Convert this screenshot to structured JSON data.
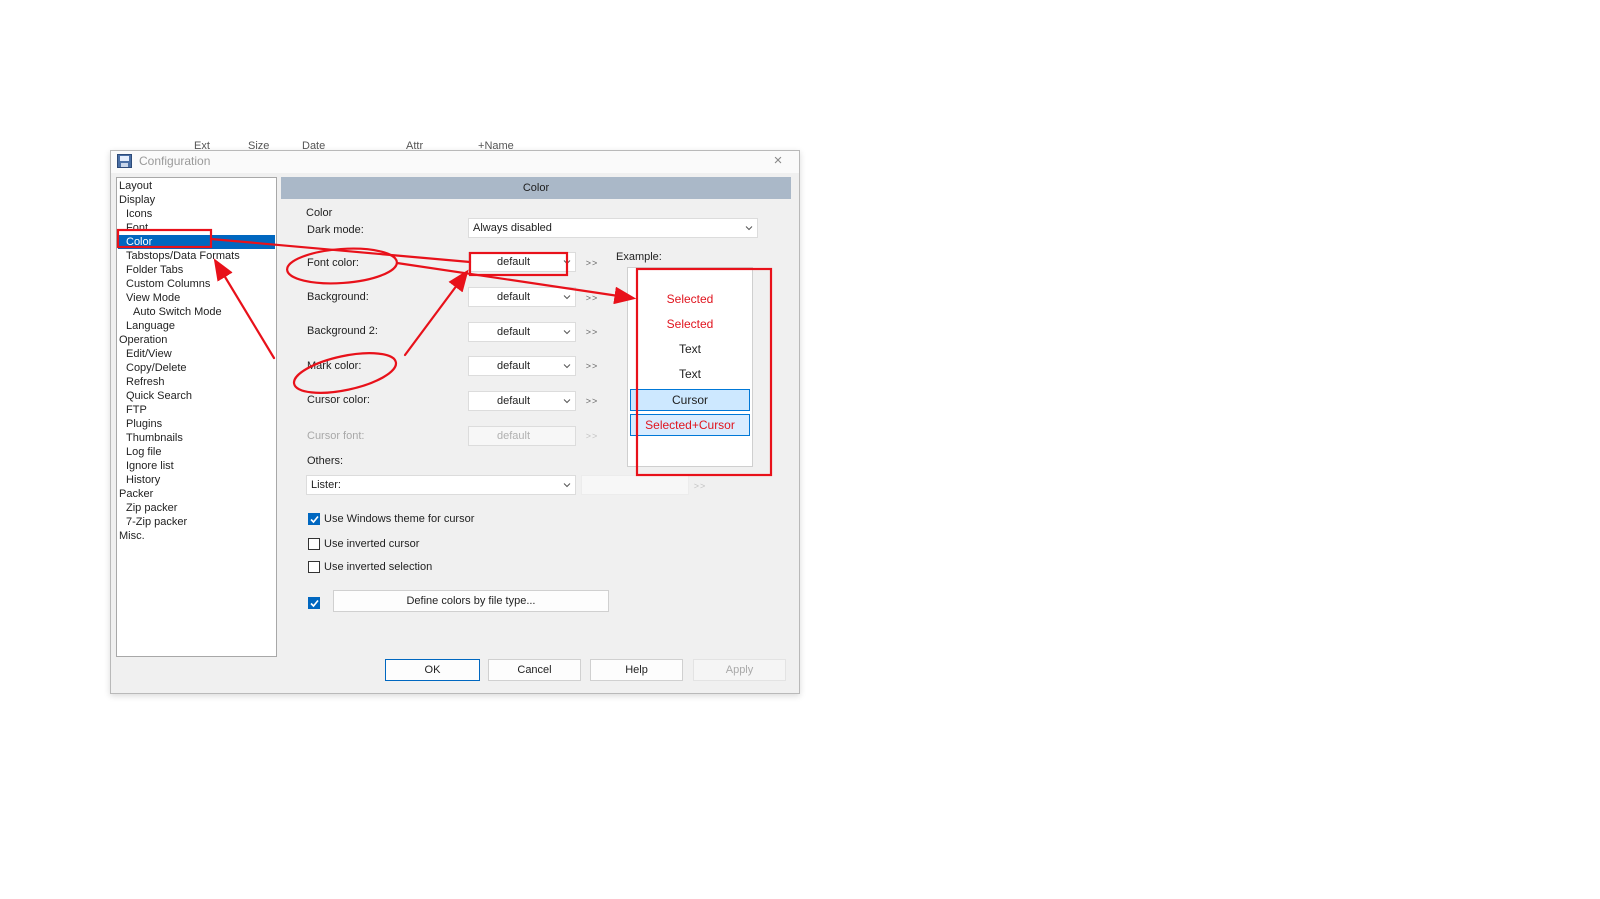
{
  "background_header": {
    "ext": "Ext",
    "size": "Size",
    "date": "Date",
    "attr": "Attr",
    "name": "Name"
  },
  "dialog": {
    "title": "Configuration",
    "close_symbol": "×"
  },
  "tree": {
    "items": [
      {
        "label": "Layout"
      },
      {
        "label": "Display"
      },
      {
        "label": "Icons"
      },
      {
        "label": "Font"
      },
      {
        "label": "Color",
        "selected": true
      },
      {
        "label": "Tabstops/Data Formats"
      },
      {
        "label": "Folder Tabs"
      },
      {
        "label": "Custom Columns"
      },
      {
        "label": "View Mode"
      },
      {
        "label": "Auto Switch Mode"
      },
      {
        "label": "Language"
      },
      {
        "label": "Operation"
      },
      {
        "label": "Edit/View"
      },
      {
        "label": "Copy/Delete"
      },
      {
        "label": "Refresh"
      },
      {
        "label": "Quick Search"
      },
      {
        "label": "FTP"
      },
      {
        "label": "Plugins"
      },
      {
        "label": "Thumbnails"
      },
      {
        "label": "Log file"
      },
      {
        "label": "Ignore list"
      },
      {
        "label": "History"
      },
      {
        "label": "Packer"
      },
      {
        "label": "Zip packer"
      },
      {
        "label": "7-Zip packer"
      },
      {
        "label": "Misc."
      }
    ]
  },
  "panel": {
    "header": "Color",
    "section_label": "Color",
    "dark_mode": {
      "label": "Dark mode:",
      "value": "Always disabled"
    },
    "font_color": {
      "label": "Font color:",
      "value": "default",
      "more": ">>"
    },
    "background": {
      "label": "Background:",
      "value": "default",
      "more": ">>"
    },
    "background2": {
      "label": "Background 2:",
      "value": "default",
      "more": ">>"
    },
    "mark_color": {
      "label": "Mark color:",
      "value": "default",
      "more": ">>"
    },
    "cursor_color": {
      "label": "Cursor color:",
      "value": "default",
      "more": ">>"
    },
    "cursor_font": {
      "label": "Cursor font:",
      "value": "default",
      "more": ">>"
    },
    "others_label": "Others:",
    "lister": {
      "value": "Lister:",
      "more": ">>"
    },
    "example": {
      "label": "Example:",
      "lines": [
        "Selected",
        "Selected",
        "Text",
        "Text",
        "Cursor",
        "Selected+Cursor"
      ]
    },
    "checkboxes": {
      "windows_theme": {
        "label": "Use Windows theme for cursor",
        "checked": true
      },
      "inverted_cursor": {
        "label": "Use inverted cursor",
        "checked": false
      },
      "inverted_selection": {
        "label": "Use inverted selection",
        "checked": false
      },
      "file_type_colors": {
        "checked": true
      }
    },
    "define_colors_button": "Define colors by file type..."
  },
  "buttons": {
    "ok": "OK",
    "cancel": "Cancel",
    "help": "Help",
    "apply": "Apply"
  },
  "colors": {
    "selection_blue": "#0067c0",
    "header_blue": "#aab8c8",
    "annotation_red": "#e8111a",
    "example_selected_text": "#e0141e"
  }
}
